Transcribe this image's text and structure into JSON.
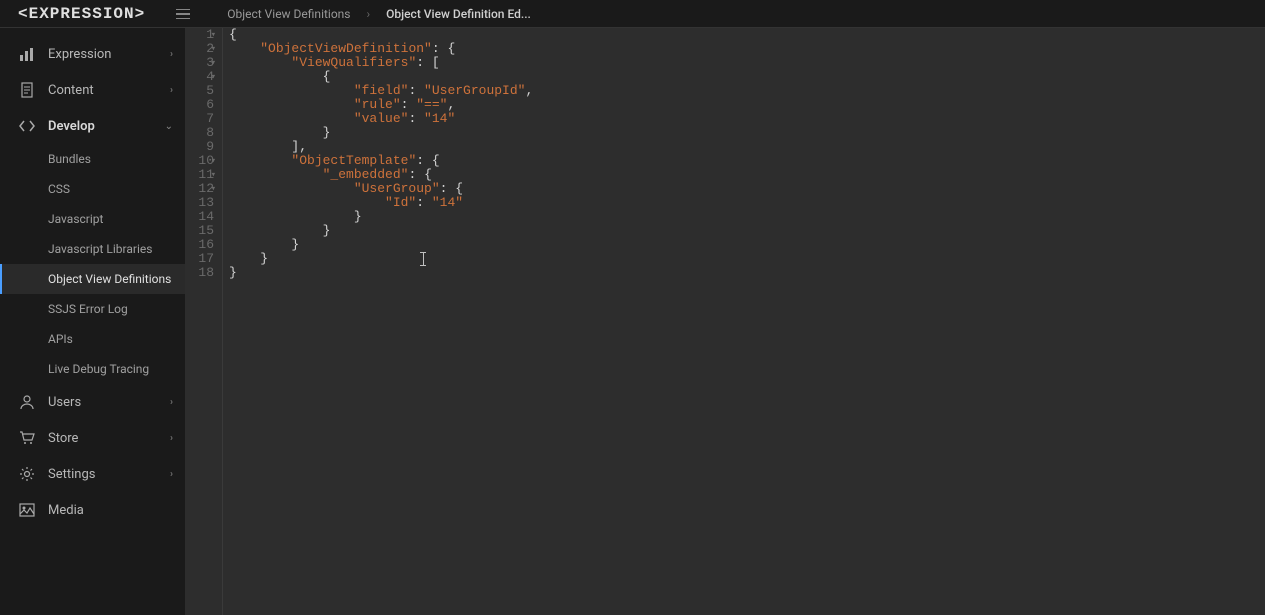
{
  "app": {
    "logo": "<EXPRESSION>"
  },
  "breadcrumb": {
    "items": [
      {
        "label": "Object View Definitions",
        "active": false
      },
      {
        "label": "Object View Definition Ed...",
        "active": true
      }
    ],
    "separator": "›"
  },
  "sidebar": {
    "items": [
      {
        "id": "expression",
        "label": "Expression",
        "icon": "chart",
        "expandable": true,
        "expanded": false
      },
      {
        "id": "content",
        "label": "Content",
        "icon": "document",
        "expandable": true,
        "expanded": false
      },
      {
        "id": "develop",
        "label": "Develop",
        "icon": "code",
        "expandable": true,
        "expanded": true,
        "children": [
          {
            "id": "bundles",
            "label": "Bundles",
            "active": false
          },
          {
            "id": "css",
            "label": "CSS",
            "active": false
          },
          {
            "id": "javascript",
            "label": "Javascript",
            "active": false
          },
          {
            "id": "js-libs",
            "label": "Javascript Libraries",
            "active": false
          },
          {
            "id": "ovd",
            "label": "Object View Definitions",
            "active": true
          },
          {
            "id": "ssjs",
            "label": "SSJS Error Log",
            "active": false
          },
          {
            "id": "apis",
            "label": "APIs",
            "active": false
          },
          {
            "id": "debug",
            "label": "Live Debug Tracing",
            "active": false
          }
        ]
      },
      {
        "id": "users",
        "label": "Users",
        "icon": "user",
        "expandable": true,
        "expanded": false
      },
      {
        "id": "store",
        "label": "Store",
        "icon": "cart",
        "expandable": true,
        "expanded": false
      },
      {
        "id": "settings",
        "label": "Settings",
        "icon": "gear",
        "expandable": true,
        "expanded": false
      },
      {
        "id": "media",
        "label": "Media",
        "icon": "image",
        "expandable": false,
        "expanded": false
      }
    ]
  },
  "editor": {
    "lines": [
      {
        "n": 1,
        "fold": true,
        "tokens": [
          {
            "c": "brace",
            "t": "{"
          }
        ]
      },
      {
        "n": 2,
        "fold": true,
        "tokens": [
          {
            "c": "",
            "t": "    "
          },
          {
            "c": "key",
            "t": "\"ObjectViewDefinition\""
          },
          {
            "c": "punct",
            "t": ": "
          },
          {
            "c": "brace",
            "t": "{"
          }
        ]
      },
      {
        "n": 3,
        "fold": true,
        "tokens": [
          {
            "c": "",
            "t": "        "
          },
          {
            "c": "key",
            "t": "\"ViewQualifiers\""
          },
          {
            "c": "punct",
            "t": ": ["
          }
        ]
      },
      {
        "n": 4,
        "fold": true,
        "tokens": [
          {
            "c": "",
            "t": "            "
          },
          {
            "c": "brace",
            "t": "{"
          }
        ]
      },
      {
        "n": 5,
        "fold": false,
        "tokens": [
          {
            "c": "",
            "t": "                "
          },
          {
            "c": "key",
            "t": "\"field\""
          },
          {
            "c": "punct",
            "t": ": "
          },
          {
            "c": "string",
            "t": "\"UserGroupId\""
          },
          {
            "c": "punct",
            "t": ","
          }
        ]
      },
      {
        "n": 6,
        "fold": false,
        "tokens": [
          {
            "c": "",
            "t": "                "
          },
          {
            "c": "key",
            "t": "\"rule\""
          },
          {
            "c": "punct",
            "t": ": "
          },
          {
            "c": "string",
            "t": "\"==\""
          },
          {
            "c": "punct",
            "t": ","
          }
        ]
      },
      {
        "n": 7,
        "fold": false,
        "tokens": [
          {
            "c": "",
            "t": "                "
          },
          {
            "c": "key",
            "t": "\"value\""
          },
          {
            "c": "punct",
            "t": ": "
          },
          {
            "c": "string",
            "t": "\"14\""
          }
        ]
      },
      {
        "n": 8,
        "fold": false,
        "tokens": [
          {
            "c": "",
            "t": "            "
          },
          {
            "c": "brace",
            "t": "}"
          }
        ]
      },
      {
        "n": 9,
        "fold": false,
        "tokens": [
          {
            "c": "",
            "t": "        "
          },
          {
            "c": "punct",
            "t": "],"
          }
        ]
      },
      {
        "n": 10,
        "fold": true,
        "tokens": [
          {
            "c": "",
            "t": "        "
          },
          {
            "c": "key",
            "t": "\"ObjectTemplate\""
          },
          {
            "c": "punct",
            "t": ": "
          },
          {
            "c": "brace",
            "t": "{"
          }
        ]
      },
      {
        "n": 11,
        "fold": true,
        "tokens": [
          {
            "c": "",
            "t": "            "
          },
          {
            "c": "key",
            "t": "\"_embedded\""
          },
          {
            "c": "punct",
            "t": ": "
          },
          {
            "c": "brace",
            "t": "{"
          }
        ]
      },
      {
        "n": 12,
        "fold": true,
        "tokens": [
          {
            "c": "",
            "t": "                "
          },
          {
            "c": "key",
            "t": "\"UserGroup\""
          },
          {
            "c": "punct",
            "t": ": "
          },
          {
            "c": "brace",
            "t": "{"
          }
        ]
      },
      {
        "n": 13,
        "fold": false,
        "tokens": [
          {
            "c": "",
            "t": "                    "
          },
          {
            "c": "key",
            "t": "\"Id\""
          },
          {
            "c": "punct",
            "t": ": "
          },
          {
            "c": "string",
            "t": "\"14\""
          }
        ]
      },
      {
        "n": 14,
        "fold": false,
        "tokens": [
          {
            "c": "",
            "t": "                "
          },
          {
            "c": "brace",
            "t": "}"
          }
        ]
      },
      {
        "n": 15,
        "fold": false,
        "tokens": [
          {
            "c": "",
            "t": "            "
          },
          {
            "c": "brace",
            "t": "}"
          }
        ]
      },
      {
        "n": 16,
        "fold": false,
        "tokens": [
          {
            "c": "",
            "t": "        "
          },
          {
            "c": "brace",
            "t": "}"
          }
        ]
      },
      {
        "n": 17,
        "fold": false,
        "tokens": [
          {
            "c": "",
            "t": "    "
          },
          {
            "c": "brace",
            "t": "}"
          }
        ]
      },
      {
        "n": 18,
        "fold": false,
        "tokens": [
          {
            "c": "brace",
            "t": "}"
          }
        ]
      }
    ],
    "cursor": {
      "line": 17,
      "col": 27
    }
  }
}
